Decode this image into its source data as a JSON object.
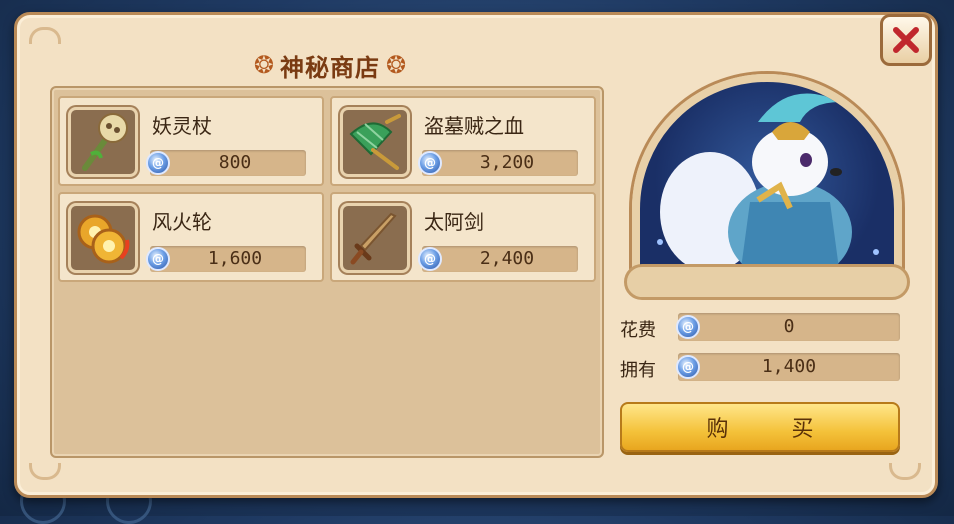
{
  "shop": {
    "title": "神秘商店",
    "items": [
      {
        "name": "妖灵杖",
        "price": "800",
        "icon": "staff-icon"
      },
      {
        "name": "盗墓贼之血",
        "price": "3,200",
        "icon": "umbrella-icon"
      },
      {
        "name": "风火轮",
        "price": "1,600",
        "icon": "fire-wheel-icon"
      },
      {
        "name": "太阿剑",
        "price": "2,400",
        "icon": "sword-icon"
      }
    ]
  },
  "summary": {
    "cost_label": "花费",
    "cost_value": "0",
    "owned_label": "拥有",
    "owned_value": "1,400"
  },
  "buy_button": "购 买",
  "currency_icon": "spirit-coin-icon",
  "colors": {
    "panel": "#f3e1c4",
    "title": "#7a3b12",
    "close_x": "#c0272d",
    "buy_button": "#f4c23a",
    "coin": "#4f7fd1"
  }
}
